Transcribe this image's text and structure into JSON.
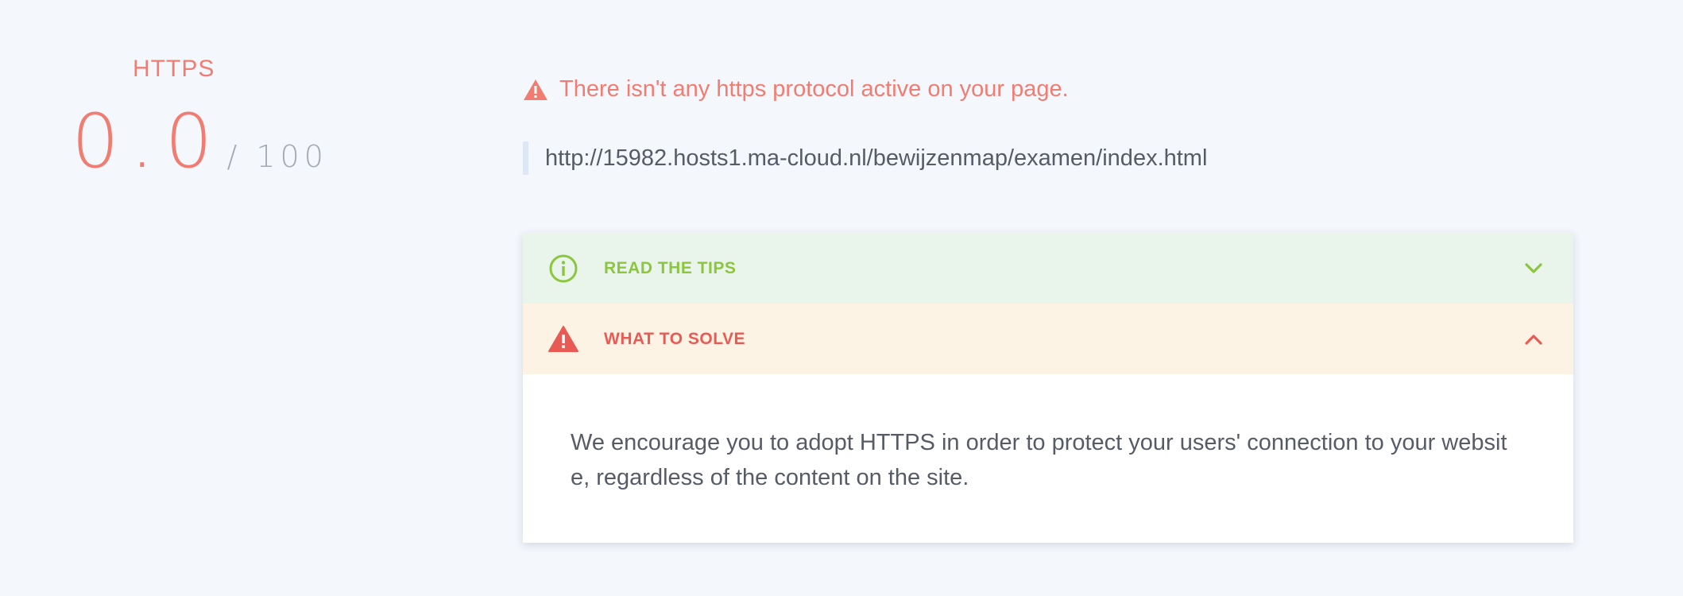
{
  "score": {
    "label": "HTTPS",
    "value": "0.0",
    "max": "/ 100"
  },
  "alert": {
    "icon": "warning-triangle-icon",
    "message": "There isn't any https protocol active on your page."
  },
  "url": "http://15982.hosts1.ma-cloud.nl/bewijzenmap/examen/index.html",
  "accordion": {
    "tips": {
      "title": "READ THE TIPS",
      "icon": "info-circle-icon",
      "expanded": false
    },
    "solve": {
      "title": "WHAT TO SOLVE",
      "icon": "warning-triangle-icon",
      "expanded": true,
      "body": "We encourage you to adopt HTTPS in order to protect your users' connection to your website, regardless of the content on the site."
    }
  },
  "colors": {
    "error": "#f07c72",
    "error_strong": "#e85b55",
    "success": "#8cc63f",
    "tips_bg": "#e9f4ea",
    "solve_bg": "#fdf3e4",
    "page_bg": "#f4f7fc"
  }
}
